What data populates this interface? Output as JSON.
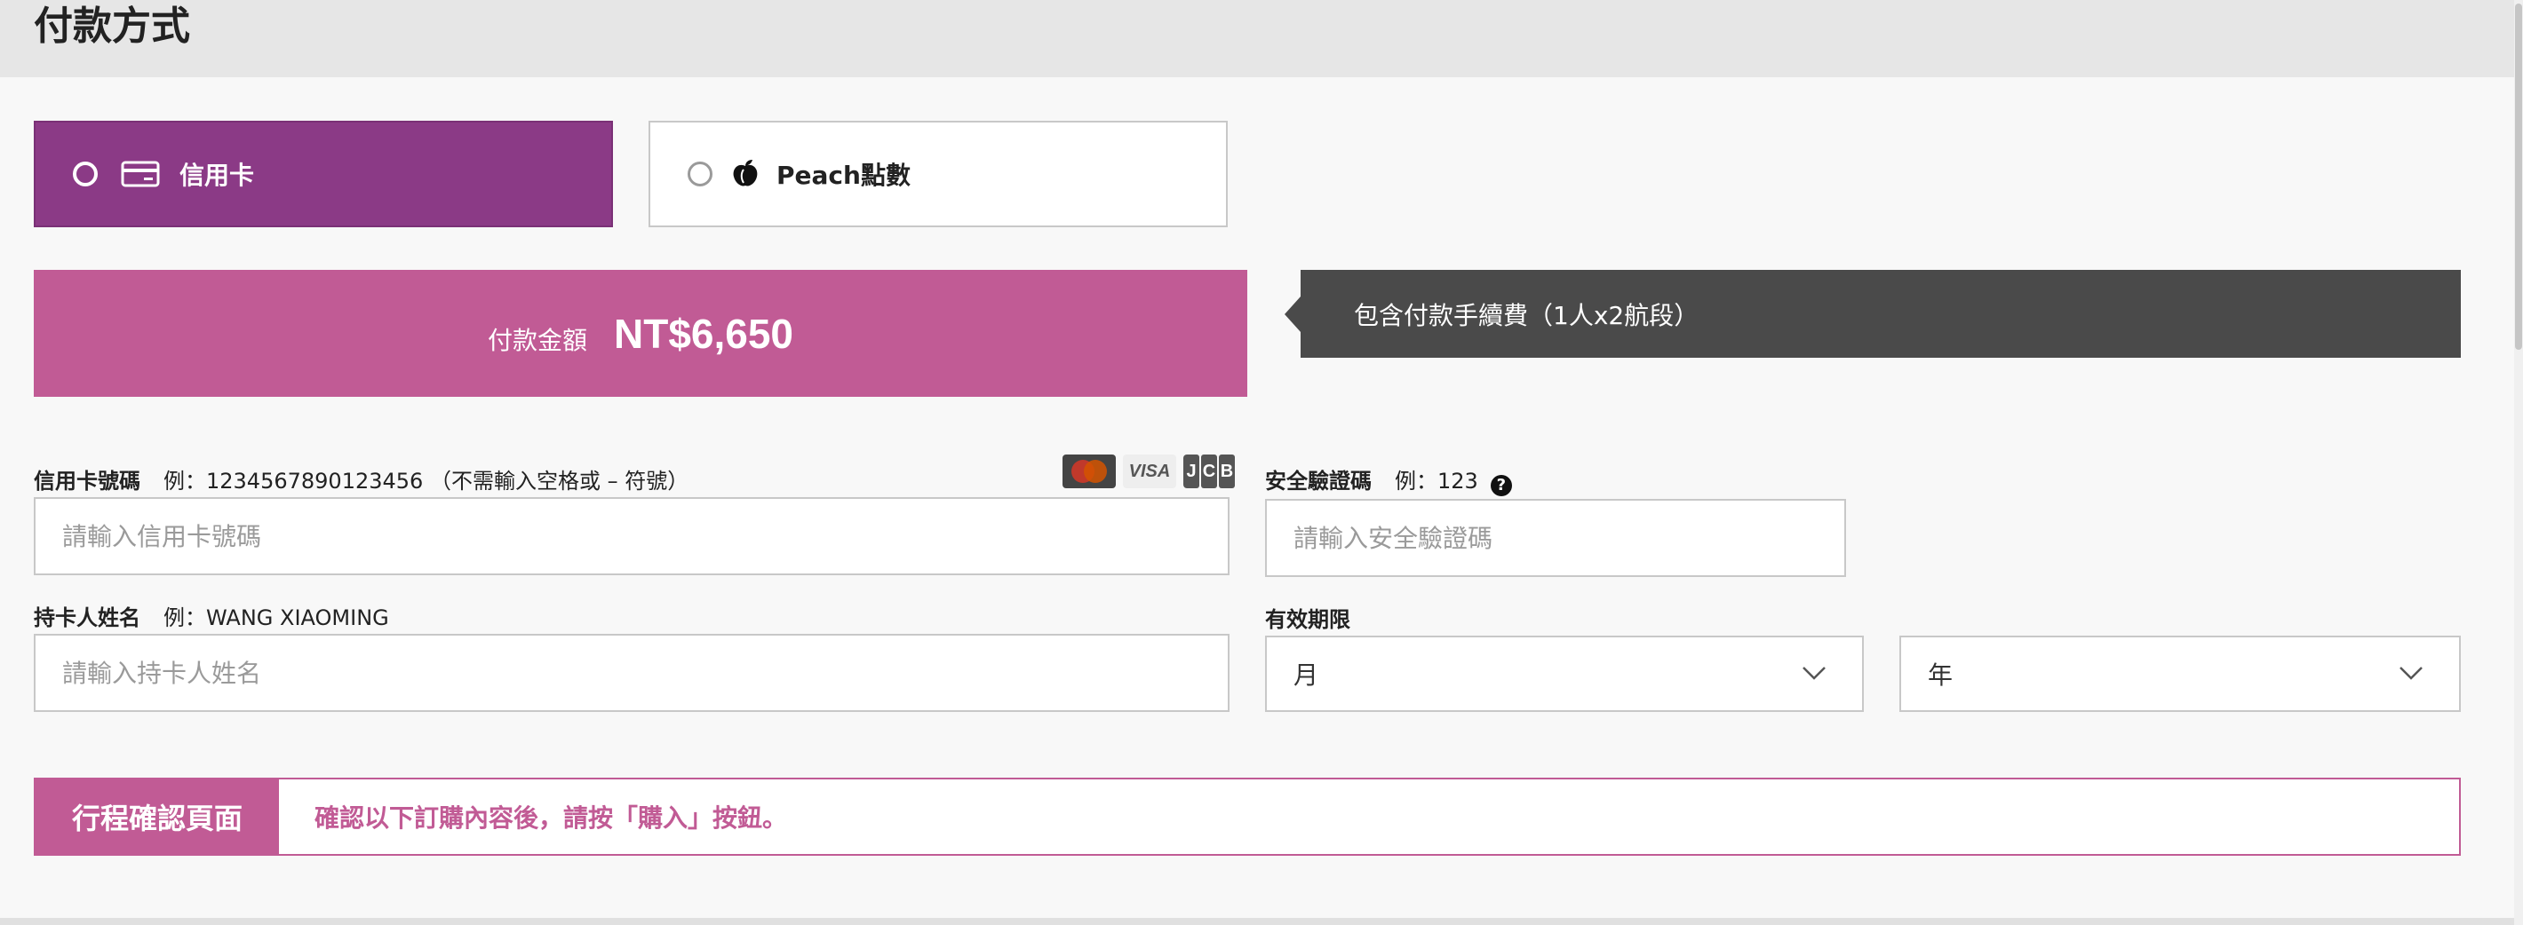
{
  "page": {
    "title": "付款方式"
  },
  "payment_options": [
    {
      "label": "信用卡",
      "icon": "credit-card-icon",
      "selected": true
    },
    {
      "label": "Peach點數",
      "icon": "peach-icon",
      "selected": false
    }
  ],
  "amount": {
    "label": "付款金額",
    "value": "NT$6,650"
  },
  "fee_note": "包含付款手續費（1人x2航段）",
  "card_number": {
    "label": "信用卡號碼",
    "hint": "例：1234567890123456 （不需輸入空格或 – 符號）",
    "placeholder": "請輸入信用卡號碼",
    "accepted_cards": [
      "MasterCard",
      "VISA",
      "JCB"
    ]
  },
  "cvv": {
    "label": "安全驗證碼",
    "hint": "例：123",
    "help": "?",
    "placeholder": "請輸入安全驗證碼"
  },
  "cardholder": {
    "label": "持卡人姓名",
    "hint": "例：WANG XIAOMING",
    "placeholder": "請輸入持卡人姓名"
  },
  "expiry": {
    "label": "有效期限",
    "month_value": "月",
    "year_value": "年"
  },
  "confirm_banner": {
    "tag": "行程確認頁面",
    "text": "確認以下訂購內容後，請按「購入」按鈕。"
  },
  "colors": {
    "primary_purple": "#8b3a86",
    "accent_pink": "#c15b95",
    "dark_note": "#4a4a4a"
  }
}
